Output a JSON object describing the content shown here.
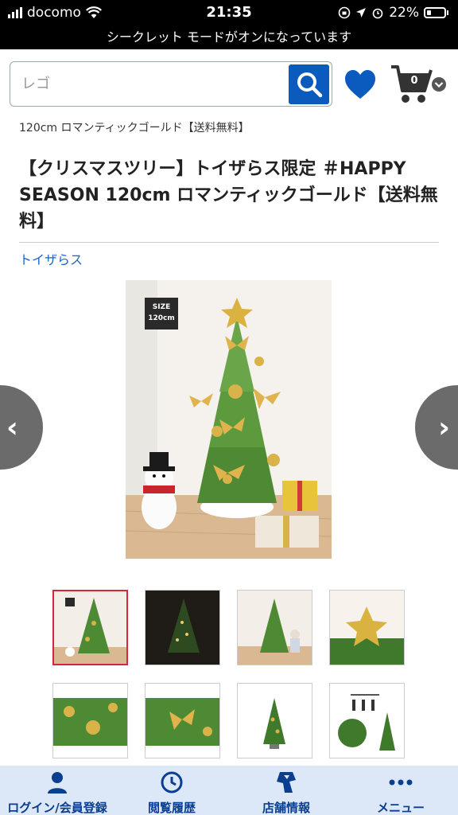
{
  "status_bar": {
    "carrier": "docomo",
    "time": "21:35",
    "battery": "22%"
  },
  "incognito_banner": "シークレット モードがオンになっています",
  "search": {
    "placeholder": "レゴ"
  },
  "cart": {
    "count": "0"
  },
  "breadcrumb": "120cm ロマンティックゴールド【送料無料】",
  "product": {
    "title": "【クリスマスツリー】トイザらス限定 ＃HAPPY SEASON 120cm ロマンティックゴールド【送料無料】",
    "brand": "トイザらス",
    "size_badge_line1": "SIZE",
    "size_badge_line2": "120cm"
  },
  "carousel": {
    "prev": "‹",
    "next": "›"
  },
  "thumbnails": [
    {
      "label": "thumb-1",
      "selected": true
    },
    {
      "label": "thumb-2",
      "selected": false
    },
    {
      "label": "thumb-3",
      "selected": false
    },
    {
      "label": "thumb-4",
      "selected": false
    },
    {
      "label": "thumb-5",
      "selected": false
    },
    {
      "label": "thumb-6",
      "selected": false
    },
    {
      "label": "thumb-7",
      "selected": false
    },
    {
      "label": "thumb-8",
      "selected": false
    }
  ],
  "bottom_nav": {
    "items": [
      {
        "label": "ログイン/会員登録",
        "icon": "person-icon"
      },
      {
        "label": "閲覧履歴",
        "icon": "clock-icon"
      },
      {
        "label": "店舗情報",
        "icon": "store-icon"
      },
      {
        "label": "メニュー",
        "icon": "more-icon"
      }
    ]
  },
  "colors": {
    "accent_blue": "#0a5bbd",
    "link_blue": "#1a64c8",
    "selected_border": "#d2283c",
    "nav_bg": "#dce7f7"
  }
}
